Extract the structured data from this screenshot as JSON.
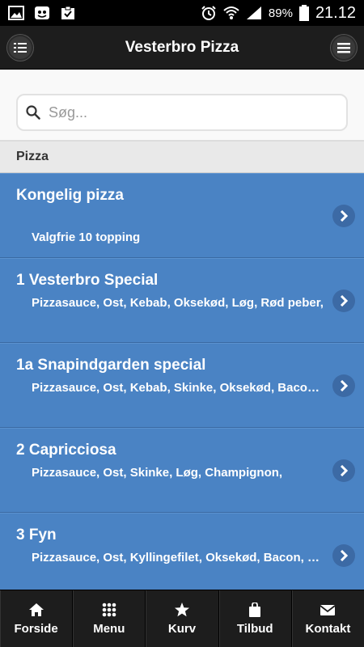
{
  "status_bar": {
    "battery": "89%",
    "time": "21.12"
  },
  "header": {
    "title": "Vesterbro Pizza",
    "left_icon": "list-icon",
    "right_icon": "menu-icon"
  },
  "search": {
    "placeholder": "Søg..."
  },
  "section": {
    "label": "Pizza"
  },
  "items": [
    {
      "title": "Kongelig pizza",
      "desc": "Valgfrie 10 topping"
    },
    {
      "title": "1 Vesterbro Special",
      "desc": "Pizzasauce, Ost, Kebab, Oksekød, Løg, Rød peber,"
    },
    {
      "title": "1a Snapindgarden special",
      "desc": "Pizzasauce, Ost, Kebab, Skinke, Oksekød, Bacon, Løg"
    },
    {
      "title": "2 Capricciosa",
      "desc": "Pizzasauce, Ost, Skinke, Løg, Champignon,"
    },
    {
      "title": "3 Fyn",
      "desc": "Pizzasauce, Ost, Kyllingefilet, Oksekød, Bacon, Løg"
    }
  ],
  "tabs": [
    {
      "label": "Forside",
      "icon": "home-icon"
    },
    {
      "label": "Menu",
      "icon": "grid-icon"
    },
    {
      "label": "Kurv",
      "icon": "star-icon"
    },
    {
      "label": "Tilbud",
      "icon": "bag-icon"
    },
    {
      "label": "Kontakt",
      "icon": "mail-icon"
    }
  ],
  "colors": {
    "list_bg": "#4a83c4",
    "header_bg": "#1d1d1d"
  }
}
